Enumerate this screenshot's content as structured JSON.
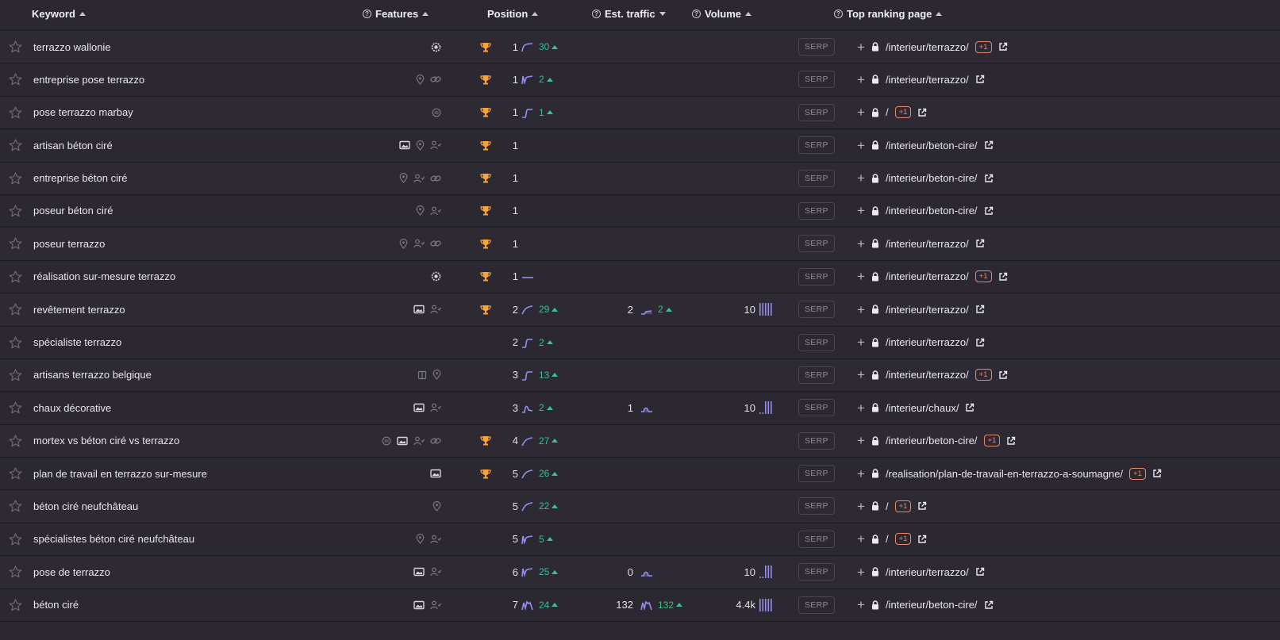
{
  "header": {
    "keyword": "Keyword",
    "features": "Features",
    "position": "Position",
    "traffic": "Est. traffic",
    "volume": "Volume",
    "top_page": "Top ranking page"
  },
  "colors": {
    "accent_green": "#3dbf8f",
    "trophy": "#f7a23a",
    "spark": "#9a8cf0",
    "badge": "#e58a6d"
  },
  "rows": [
    {
      "keyword": "terrazzo wallonie",
      "features": [
        "sitelinks-icon"
      ],
      "trophy": true,
      "position": "1",
      "spark": "up",
      "change": "30",
      "traffic": "",
      "tspark": "",
      "tchange": "",
      "volume": "",
      "vbars": "",
      "serp": "SERP",
      "page": "/interieur/terrazzo/",
      "badge": "+1"
    },
    {
      "keyword": "entreprise pose terrazzo",
      "features": [
        "location-icon",
        "link-icon"
      ],
      "trophy": true,
      "position": "1",
      "spark": "spike",
      "change": "2",
      "traffic": "",
      "tspark": "",
      "tchange": "",
      "volume": "",
      "vbars": "",
      "serp": "SERP",
      "page": "/interieur/terrazzo/",
      "badge": ""
    },
    {
      "keyword": "pose terrazzo marbay",
      "features": [
        "chat-icon"
      ],
      "trophy": true,
      "position": "1",
      "spark": "step",
      "change": "1",
      "traffic": "",
      "tspark": "",
      "tchange": "",
      "volume": "",
      "vbars": "",
      "serp": "SERP",
      "page": "/",
      "badge": "+1"
    },
    {
      "keyword": "artisan béton ciré",
      "features": [
        "image-icon",
        "location-icon",
        "people-icon"
      ],
      "trophy": true,
      "position": "1",
      "spark": "",
      "change": "",
      "traffic": "",
      "tspark": "",
      "tchange": "",
      "volume": "",
      "vbars": "",
      "serp": "SERP",
      "page": "/interieur/beton-cire/",
      "badge": ""
    },
    {
      "keyword": "entreprise béton ciré",
      "features": [
        "location-icon",
        "people-icon",
        "link-icon"
      ],
      "trophy": true,
      "position": "1",
      "spark": "",
      "change": "",
      "traffic": "",
      "tspark": "",
      "tchange": "",
      "volume": "",
      "vbars": "",
      "serp": "SERP",
      "page": "/interieur/beton-cire/",
      "badge": ""
    },
    {
      "keyword": "poseur béton ciré",
      "features": [
        "location-icon",
        "people-icon"
      ],
      "trophy": true,
      "position": "1",
      "spark": "",
      "change": "",
      "traffic": "",
      "tspark": "",
      "tchange": "",
      "volume": "",
      "vbars": "",
      "serp": "SERP",
      "page": "/interieur/beton-cire/",
      "badge": ""
    },
    {
      "keyword": "poseur terrazzo",
      "features": [
        "location-icon",
        "people-icon",
        "link-icon"
      ],
      "trophy": true,
      "position": "1",
      "spark": "",
      "change": "",
      "traffic": "",
      "tspark": "",
      "tchange": "",
      "volume": "",
      "vbars": "",
      "serp": "SERP",
      "page": "/interieur/terrazzo/",
      "badge": ""
    },
    {
      "keyword": "réalisation sur-mesure terrazzo",
      "features": [
        "sitelinks-icon"
      ],
      "trophy": true,
      "position": "1",
      "spark": "flat",
      "change": "",
      "traffic": "",
      "tspark": "",
      "tchange": "",
      "volume": "",
      "vbars": "",
      "serp": "SERP",
      "page": "/interieur/terrazzo/",
      "badge": "+1"
    },
    {
      "keyword": "revêtement terrazzo",
      "features": [
        "image-icon",
        "people-icon"
      ],
      "trophy": true,
      "position": "2",
      "spark": "curve",
      "change": "29",
      "traffic": "2",
      "tspark": "rise",
      "tchange": "2",
      "volume": "10",
      "vbars": "full",
      "serp": "SERP",
      "page": "/interieur/terrazzo/",
      "badge": ""
    },
    {
      "keyword": "spécialiste terrazzo",
      "features": [],
      "trophy": false,
      "position": "2",
      "spark": "step",
      "change": "2",
      "traffic": "",
      "tspark": "",
      "tchange": "",
      "volume": "",
      "vbars": "",
      "serp": "SERP",
      "page": "/interieur/terrazzo/",
      "badge": ""
    },
    {
      "keyword": "artisans terrazzo belgique",
      "features": [
        "panel-icon",
        "location-icon"
      ],
      "trophy": false,
      "position": "3",
      "spark": "step",
      "change": "13",
      "traffic": "",
      "tspark": "",
      "tchange": "",
      "volume": "",
      "vbars": "",
      "serp": "SERP",
      "page": "/interieur/terrazzo/",
      "badge": "+1"
    },
    {
      "keyword": "chaux décorative",
      "features": [
        "image-icon",
        "people-icon"
      ],
      "trophy": false,
      "position": "3",
      "spark": "bump",
      "change": "2",
      "traffic": "1",
      "tspark": "hump",
      "tchange": "",
      "volume": "10",
      "vbars": "partial",
      "serp": "SERP",
      "page": "/interieur/chaux/",
      "badge": ""
    },
    {
      "keyword": "mortex vs béton ciré vs terrazzo",
      "features": [
        "chat-icon",
        "image-icon",
        "people-icon",
        "link-icon"
      ],
      "trophy": true,
      "position": "4",
      "spark": "curve",
      "change": "27",
      "traffic": "",
      "tspark": "",
      "tchange": "",
      "volume": "",
      "vbars": "",
      "serp": "SERP",
      "page": "/interieur/beton-cire/",
      "badge": "+1"
    },
    {
      "keyword": "plan de travail en terrazzo sur-mesure",
      "features": [
        "image-icon"
      ],
      "trophy": true,
      "position": "5",
      "spark": "curve",
      "change": "26",
      "traffic": "",
      "tspark": "",
      "tchange": "",
      "volume": "",
      "vbars": "",
      "serp": "SERP",
      "page": "/realisation/plan-de-travail-en-terrazzo-a-soumagne/",
      "badge": "+1"
    },
    {
      "keyword": "béton ciré neufchâteau",
      "features": [
        "location-icon"
      ],
      "trophy": false,
      "position": "5",
      "spark": "curve",
      "change": "22",
      "traffic": "",
      "tspark": "",
      "tchange": "",
      "volume": "",
      "vbars": "",
      "serp": "SERP",
      "page": "/",
      "badge": "+1"
    },
    {
      "keyword": "spécialistes béton ciré neufchâteau",
      "features": [
        "location-icon",
        "people-icon"
      ],
      "trophy": false,
      "position": "5",
      "spark": "spike",
      "change": "5",
      "traffic": "",
      "tspark": "",
      "tchange": "",
      "volume": "",
      "vbars": "",
      "serp": "SERP",
      "page": "/",
      "badge": "+1"
    },
    {
      "keyword": "pose de terrazzo",
      "features": [
        "image-icon",
        "people-icon"
      ],
      "trophy": false,
      "position": "6",
      "spark": "spike",
      "change": "25",
      "traffic": "0",
      "tspark": "hump",
      "tchange": "",
      "volume": "10",
      "vbars": "partial",
      "serp": "SERP",
      "page": "/interieur/terrazzo/",
      "badge": ""
    },
    {
      "keyword": "béton ciré",
      "features": [
        "image-icon",
        "people-icon"
      ],
      "trophy": false,
      "position": "7",
      "spark": "zig",
      "change": "24",
      "traffic": "132",
      "tspark": "zig",
      "tchange": "132",
      "volume": "4.4k",
      "vbars": "full",
      "serp": "SERP",
      "page": "/interieur/beton-cire/",
      "badge": ""
    }
  ]
}
